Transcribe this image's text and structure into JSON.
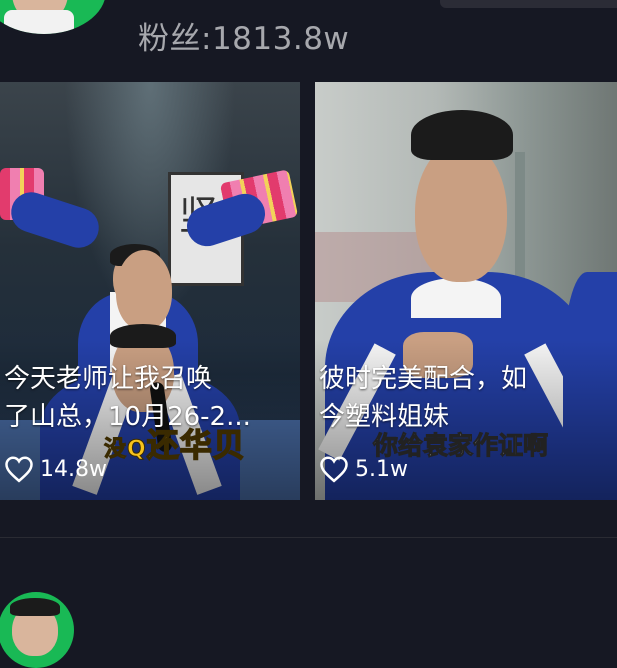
{
  "profile": {
    "fans_text": "粉丝:1813.8w"
  },
  "videos": [
    {
      "title_line1": "今天老师让我召唤",
      "title_line2": "了山总，10月26-2...",
      "overlay_subtitle_small": "没Q",
      "overlay_subtitle": "还华贝",
      "poster_char": "竖",
      "likes": "14.8w"
    },
    {
      "title_line1": "彼时完美配合，如",
      "title_line2": "今塑料姐妹",
      "overlay_subtitle": "你给袁家作证啊",
      "likes": "5.1w"
    }
  ],
  "colors": {
    "background": "#161823",
    "avatar_green": "#19b955",
    "fans_text": "#a7a8ad",
    "subtitle_yellow": "#f7c21c"
  },
  "icons": [
    "avatar",
    "heart-outline-icon"
  ]
}
